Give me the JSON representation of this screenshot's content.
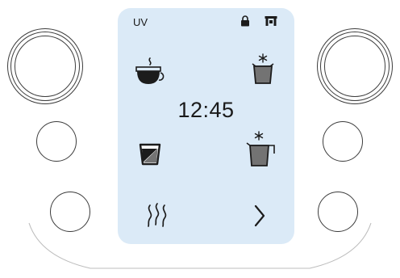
{
  "display": {
    "mode_label": "UV",
    "time": "12:45"
  },
  "icons": {
    "status": [
      "lock-icon",
      "screen-lock-icon"
    ],
    "tiles": [
      "coffee-cup-icon",
      "cold-cup-icon",
      "hot-water-icon",
      "cold-jug-icon",
      "steam-icon",
      "chevron-right-icon"
    ]
  },
  "colors": {
    "screen_background": "#dbeaf7",
    "icon_color": "#1c1c1c",
    "fill_color": "#737373",
    "outline_color": "#3c3c3c"
  }
}
